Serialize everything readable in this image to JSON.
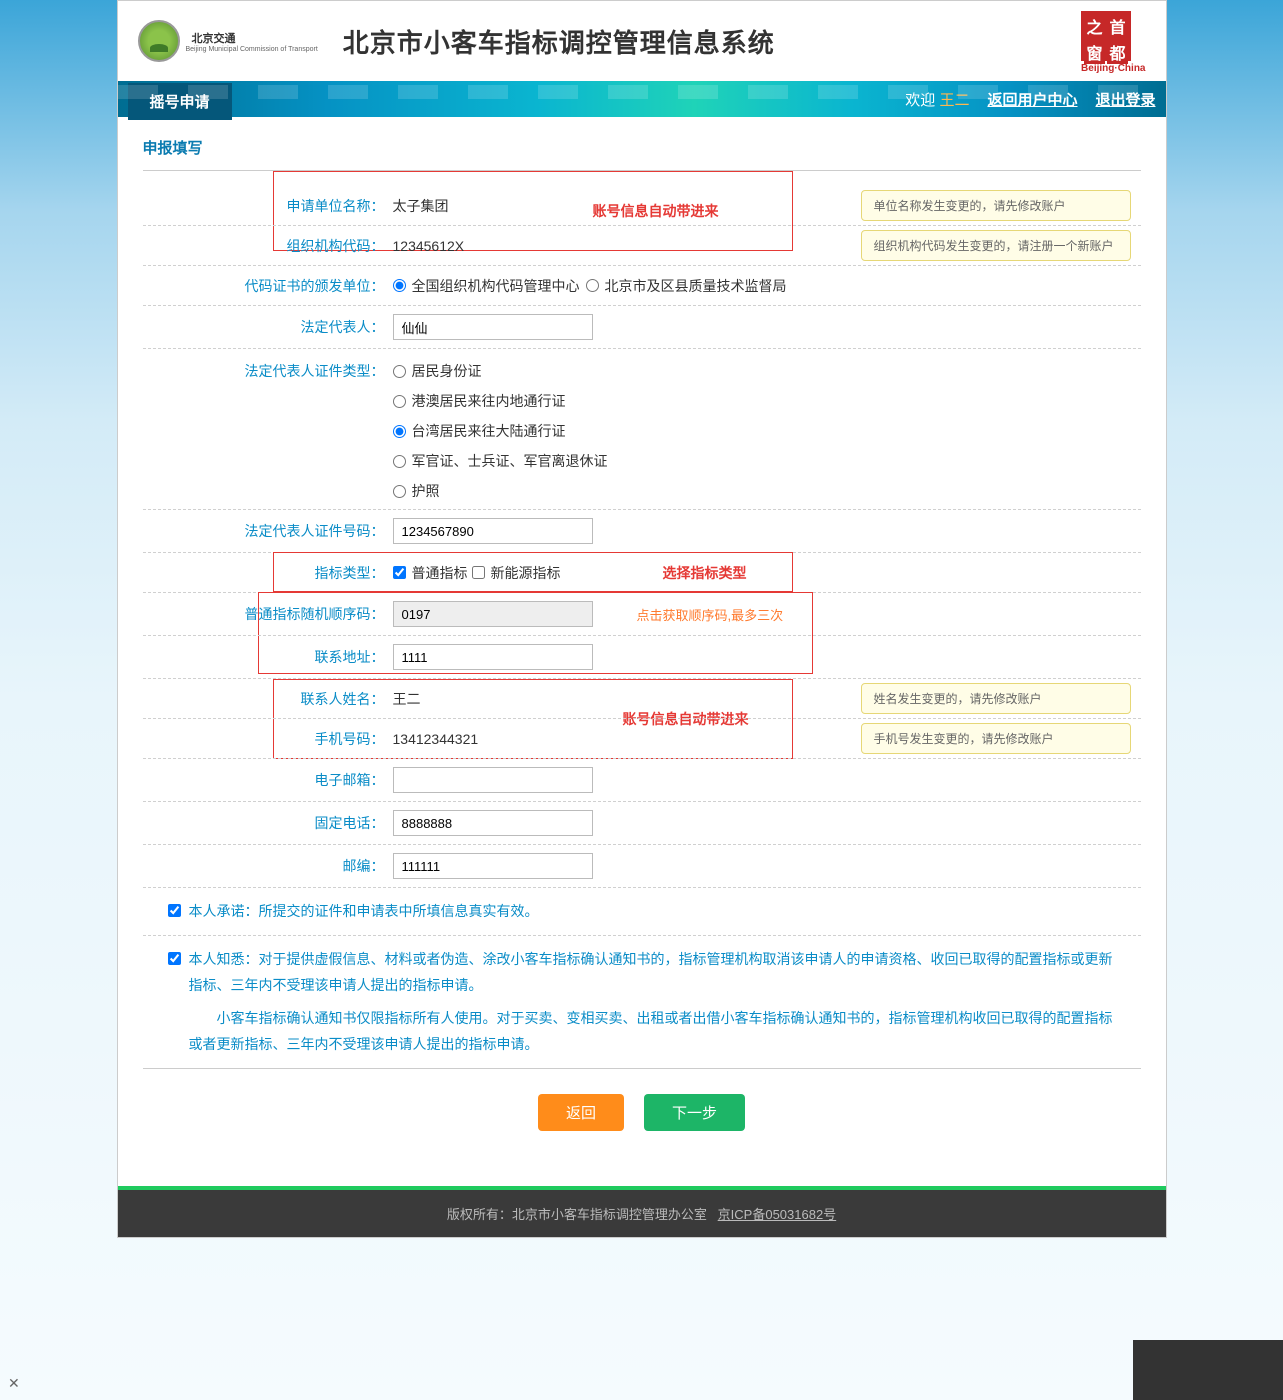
{
  "header": {
    "logo_text": "北京交通",
    "logo_sub": "Beijing Municipal Commission of Transport",
    "title": "北京市小客车指标调控管理信息系统",
    "seal": [
      "之",
      "首",
      "窗",
      "都"
    ],
    "seal_text": "Beijing·China"
  },
  "nav": {
    "tab": "摇号申请",
    "welcome": "欢迎",
    "username": "王二",
    "return_user_center": "返回用户中心",
    "logout": "退出登录"
  },
  "section_title": "申报填写",
  "form": {
    "unit_name_label": "申请单位名称：",
    "unit_name_value": "太子集团",
    "unit_name_hint": "单位名称发生变更的，请先修改账户",
    "org_code_label": "组织机构代码：",
    "org_code_value": "12345612X",
    "org_code_hint": "组织机构代码发生变更的，请注册一个新账户",
    "annotation1": "账号信息自动带进来",
    "issuer_label": "代码证书的颁发单位：",
    "issuer_opt1": "全国组织机构代码管理中心",
    "issuer_opt2": "北京市及区县质量技术监督局",
    "legal_rep_label": "法定代表人：",
    "legal_rep_value": "仙仙",
    "id_type_label": "法定代表人证件类型：",
    "id_type_opts": [
      "居民身份证",
      "港澳居民来往内地通行证",
      "台湾居民来往大陆通行证",
      "军官证、士兵证、军官离退休证",
      "护照"
    ],
    "id_number_label": "法定代表人证件号码：",
    "id_number_value": "1234567890",
    "quota_type_label": "指标类型：",
    "quota_type_opt1": "普通指标",
    "quota_type_opt2": "新能源指标",
    "annotation2": "选择指标类型",
    "seq_label": "普通指标随机顺序码：",
    "seq_value": "0197",
    "seq_hint": "点击获取顺序码,最多三次",
    "address_label": "联系地址：",
    "address_value": "1111",
    "contact_name_label": "联系人姓名：",
    "contact_name_value": "王二",
    "contact_name_hint": "姓名发生变更的，请先修改账户",
    "mobile_label": "手机号码：",
    "mobile_value": "13412344321",
    "mobile_hint": "手机号发生变更的，请先修改账户",
    "annotation3": "账号信息自动带进来",
    "email_label": "电子邮箱：",
    "email_value": "",
    "phone_label": "固定电话：",
    "phone_value": "8888888",
    "zip_label": "邮编：",
    "zip_value": "111111"
  },
  "agreements": {
    "a1": "本人承诺：所提交的证件和申请表中所填信息真实有效。",
    "a2_p1": "本人知悉：对于提供虚假信息、材料或者伪造、涂改小客车指标确认通知书的，指标管理机构取消该申请人的申请资格、收回已取得的配置指标或更新指标、三年内不受理该申请人提出的指标申请。",
    "a2_p2": "小客车指标确认通知书仅限指标所有人使用。对于买卖、变相买卖、出租或者出借小客车指标确认通知书的，指标管理机构收回已取得的配置指标或者更新指标、三年内不受理该申请人提出的指标申请。"
  },
  "buttons": {
    "back": "返回",
    "next": "下一步"
  },
  "footer": {
    "copyright": "版权所有：北京市小客车指标调控管理办公室",
    "icp": "京ICP备05031682号"
  }
}
